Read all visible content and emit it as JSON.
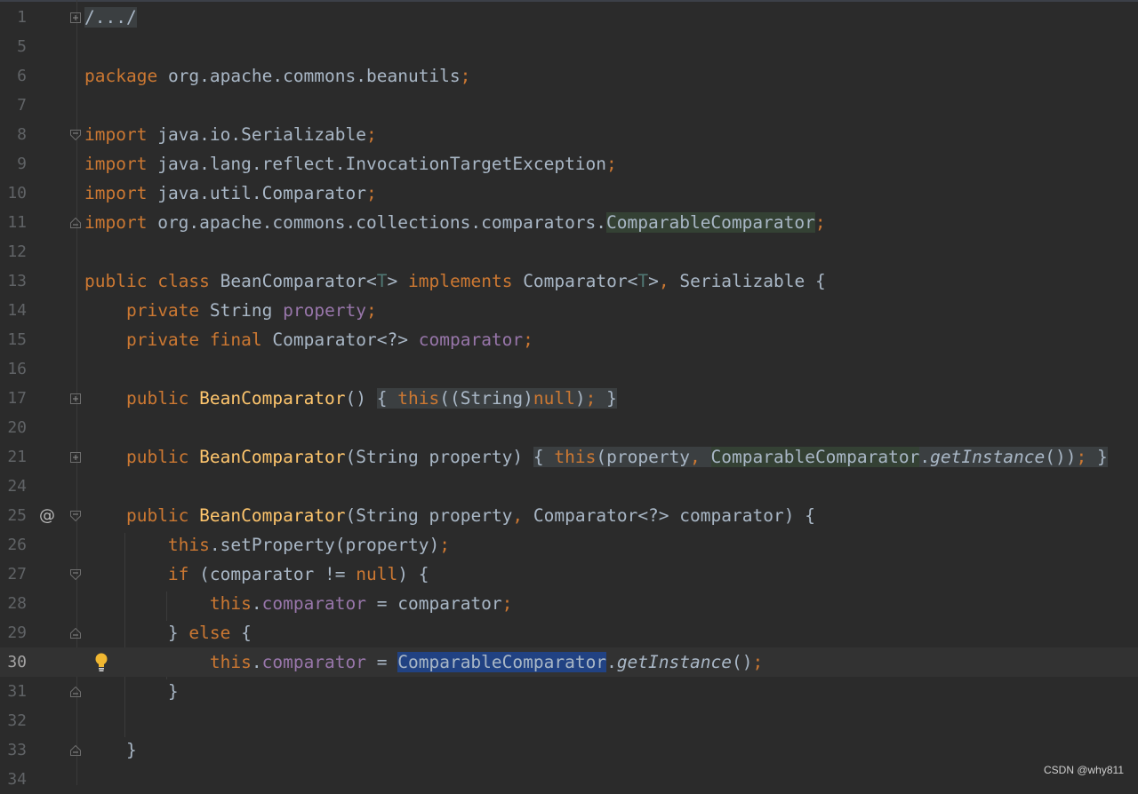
{
  "editor": {
    "current_line": "30",
    "lines": [
      {
        "ln": "1"
      },
      {
        "ln": "5"
      },
      {
        "ln": "6"
      },
      {
        "ln": "7"
      },
      {
        "ln": "8"
      },
      {
        "ln": "9"
      },
      {
        "ln": "10"
      },
      {
        "ln": "11"
      },
      {
        "ln": "12"
      },
      {
        "ln": "13"
      },
      {
        "ln": "14"
      },
      {
        "ln": "15"
      },
      {
        "ln": "16"
      },
      {
        "ln": "17"
      },
      {
        "ln": "20"
      },
      {
        "ln": "21"
      },
      {
        "ln": "24"
      },
      {
        "ln": "25"
      },
      {
        "ln": "26"
      },
      {
        "ln": "27"
      },
      {
        "ln": "28"
      },
      {
        "ln": "29"
      },
      {
        "ln": "30"
      },
      {
        "ln": "31"
      },
      {
        "ln": "32"
      },
      {
        "ln": "33"
      },
      {
        "ln": "34"
      }
    ],
    "code": {
      "l1": "/.../",
      "l6_kw": "package",
      "l6_rest": "org.apache.commons.beanutils",
      "semi": ";",
      "kw_import": "import",
      "l8_rest": "java.io.Serializable",
      "l9_rest": "java.lang.reflect.InvocationTargetException",
      "l10_rest": "java.util.Comparator",
      "l11_pre": "org.apache.commons.collections.comparators.",
      "cmp_cls": "ComparableComparator",
      "kw_public": "public",
      "kw_class": "class",
      "cls_name": "BeanComparator",
      "lt": "<",
      "gt": ">",
      "type_t": "T",
      "kw_implements": "implements",
      "comparator": "Comparator",
      "comma_sp": ",",
      "serializable": "Serializable",
      "open_brace": "{",
      "close_brace": "}",
      "kw_private": "private",
      "string": "String",
      "fld_property": "property",
      "kw_final": "final",
      "wild": "<?>",
      "fld_comparator": "comparator",
      "ctor_name": "BeanComparator",
      "empty_parens": "()",
      "kw_this": "this",
      "cast": "((String)",
      "kw_null": "null",
      "close_paren": ")",
      "open_paren": "(",
      "param_string_property": "String property",
      "param_property": "property",
      "dot": ".",
      "get_instance": "getInstance",
      "end_call": "())",
      "comparator_param": "Comparator<?> comparator",
      "set_property": "setProperty",
      "kw_if": "if",
      "cond": "(comparator != ",
      "assign": " = ",
      "comparator_var": "comparator",
      "kw_else": "else",
      "call_close": "()"
    }
  },
  "watermark": "CSDN @why811",
  "icons": {
    "annotation": "@",
    "bulb": "intention-bulb-icon"
  }
}
